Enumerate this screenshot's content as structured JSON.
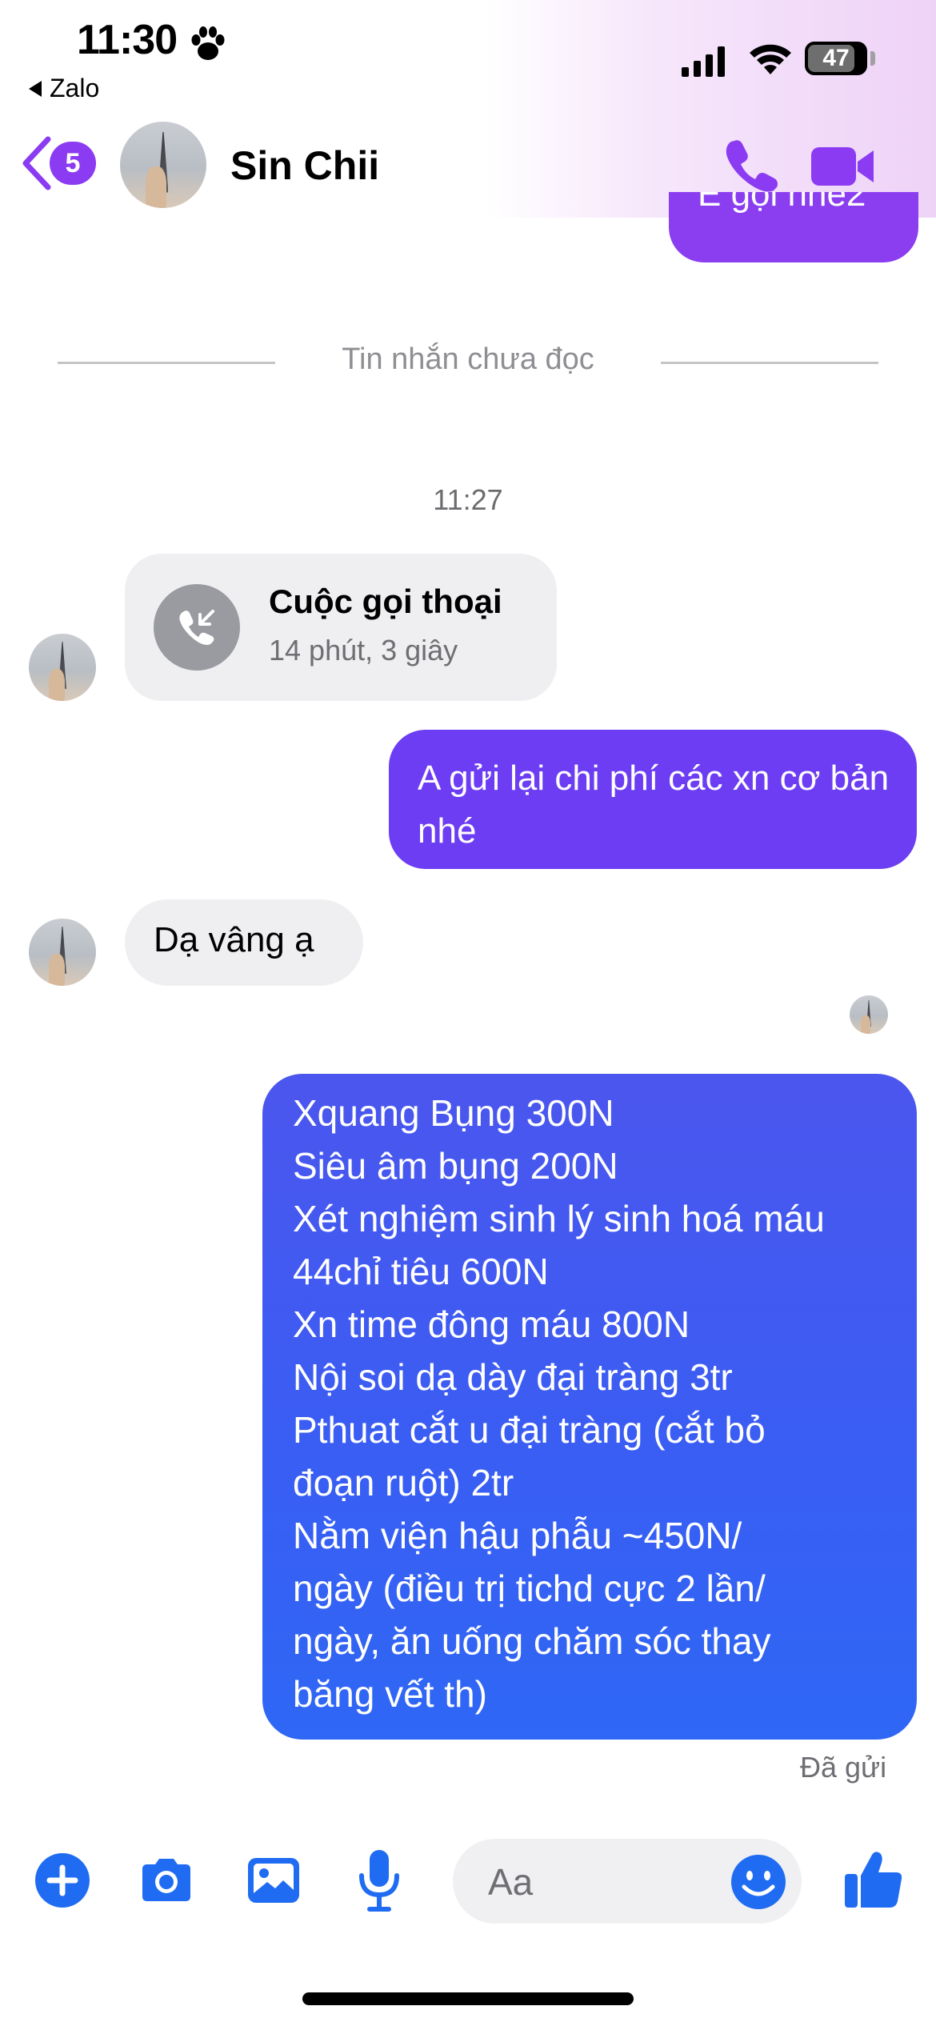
{
  "status_bar": {
    "time": "11:30",
    "back_app": "Zalo",
    "battery": "47",
    "paw_icon": "paw-icon",
    "signal_icon": "cellular-signal-icon",
    "wifi_icon": "wifi-icon",
    "battery_icon": "battery-icon"
  },
  "header": {
    "back_icon": "chevron-left-icon",
    "unread_count": "5",
    "contact_name": "Sin Chii",
    "phone_icon": "phone-icon",
    "video_icon": "video-camera-icon",
    "accent_color": "#8b3bf1"
  },
  "chat": {
    "partial_message": "E gọi nhé2",
    "unread_divider": "Tin nhắn chưa đọc",
    "timestamp": "11:27",
    "call": {
      "title": "Cuộc gọi thoại",
      "duration": "14 phút, 3 giây",
      "icon": "incoming-call-icon"
    },
    "outgoing_1": "A gửi lại chi phí các xn cơ bản nhé",
    "incoming_1": "Dạ vâng ạ",
    "outgoing_2_lines": [
      "Xquang Bụng 300N",
      "Siêu âm bụng 200N",
      "Xét nghiệm sinh lý sinh hoá máu",
      "44chỉ tiêu 600N",
      "Xn time đông máu 800N",
      "Nội soi dạ dày đại tràng 3tr",
      "Pthuat cắt u đại tràng (cắt bỏ",
      "đoạn ruột) 2tr",
      "Nằm viện hậu phẫu ~450N/",
      "ngày (điều trị tichd cực 2 lần/",
      "ngày, ăn uống chăm sóc thay",
      "băng vết th)"
    ],
    "sent_status": "Đã gửi"
  },
  "composer": {
    "placeholder": "Aa",
    "icons": [
      "plus-icon",
      "camera-icon",
      "photo-icon",
      "microphone-icon",
      "emoji-icon",
      "thumbs-up-icon"
    ],
    "icon_color": "#1f6cf2"
  }
}
